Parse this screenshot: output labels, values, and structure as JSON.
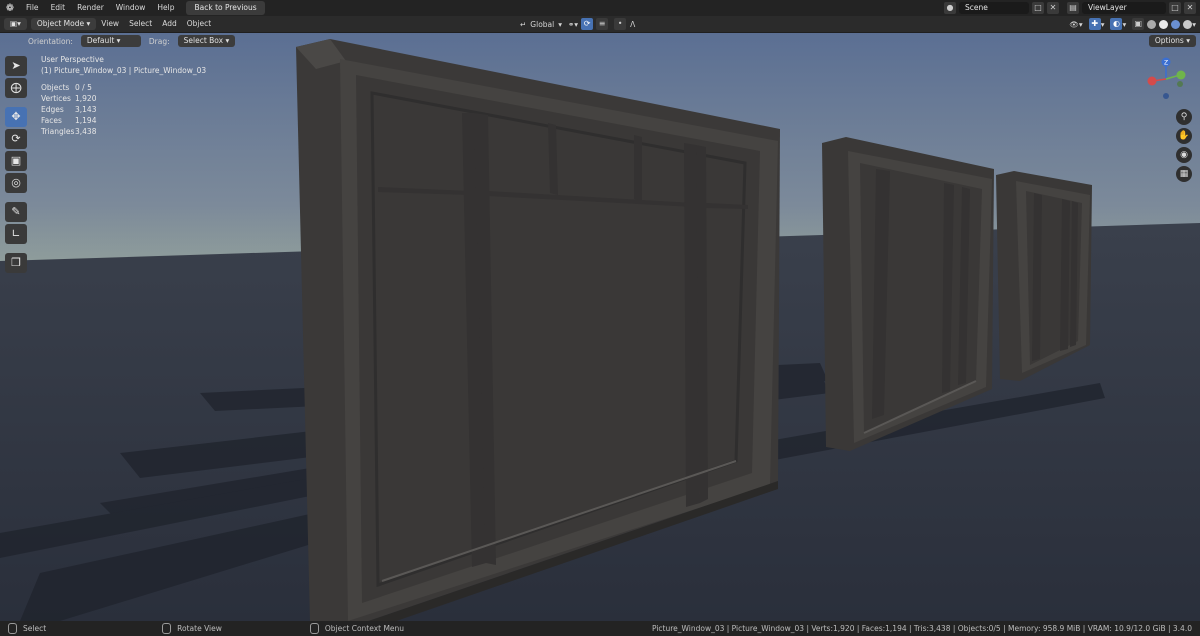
{
  "topbar": {
    "menus": [
      "File",
      "Edit",
      "Render",
      "Window",
      "Help"
    ],
    "back_label": "Back to Previous",
    "scene_label": "Scene",
    "viewlayer_label": "ViewLayer"
  },
  "header": {
    "mode_label": "Object Mode",
    "menus": [
      "View",
      "Select",
      "Add",
      "Object"
    ],
    "transform_orientation": "Global"
  },
  "tool_header": {
    "orientation_label": "Orientation:",
    "orientation_value": "Default",
    "drag_label": "Drag:",
    "drag_value": "Select Box",
    "options_label": "Options"
  },
  "viewport": {
    "view_name": "User Perspective",
    "active_object": "(1) Picture_Window_03 | Picture_Window_03",
    "stats": [
      {
        "label": "Objects",
        "value": "0 / 5"
      },
      {
        "label": "Vertices",
        "value": "1,920"
      },
      {
        "label": "Edges",
        "value": "3,143"
      },
      {
        "label": "Faces",
        "value": "1,194"
      },
      {
        "label": "Triangles",
        "value": "3,438"
      }
    ]
  },
  "gizmo": {
    "z_label": "Z",
    "y_label": "Y",
    "x_label": "X"
  },
  "toolbar_icons": [
    "select-box-icon",
    "cursor-icon",
    "move-icon",
    "rotate-icon",
    "scale-icon",
    "transform-icon",
    "annotate-icon",
    "measure-icon",
    "add-cube-icon"
  ],
  "statusbar": {
    "select_label": "Select",
    "rotate_label": "Rotate View",
    "context_label": "Object Context Menu",
    "info": "Picture_Window_03 | Picture_Window_03 | Verts:1,920 | Faces:1,194 | Tris:3,438 | Objects:0/5 | Memory: 958.9 MiB | VRAM: 10.9/12.0 GiB | 3.4.0"
  },
  "colors": {
    "accent": "#4772b3",
    "sky_top": "#5b6f93",
    "sky_horizon": "#8f9d9b",
    "floor": "#2e3441",
    "frame": "#3f3d3c"
  }
}
